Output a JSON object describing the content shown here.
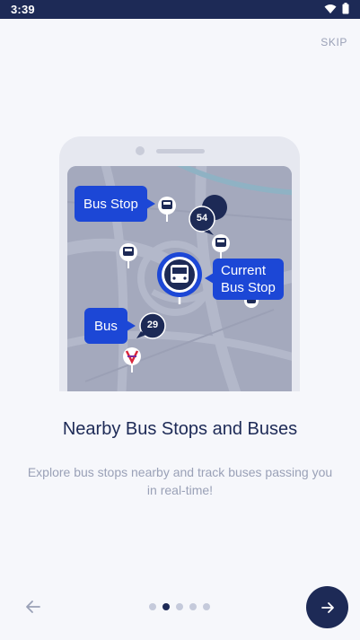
{
  "status_bar": {
    "time": "3:39",
    "icons": [
      "wifi-icon",
      "battery-icon"
    ]
  },
  "header": {
    "skip_label": "SKIP"
  },
  "illustration": {
    "bubbles": {
      "bus_stop": "Bus Stop",
      "current_line1": "Current",
      "current_line2": "Bus Stop",
      "bus": "Bus"
    },
    "markers": {
      "bus_a": "54",
      "bus_b": "29"
    }
  },
  "content": {
    "title": "Nearby Bus Stops and Buses",
    "subtitle": "Explore bus stops nearby and track buses passing you in real-time!"
  },
  "pager": {
    "total": 5,
    "active_index": 1
  },
  "colors": {
    "primary": "#1d2a56",
    "accent": "#1c47d6",
    "muted": "#9aa1b7",
    "background": "#f6f7fb"
  },
  "icons": {
    "back": "arrow-left-icon",
    "next": "arrow-right-icon"
  }
}
